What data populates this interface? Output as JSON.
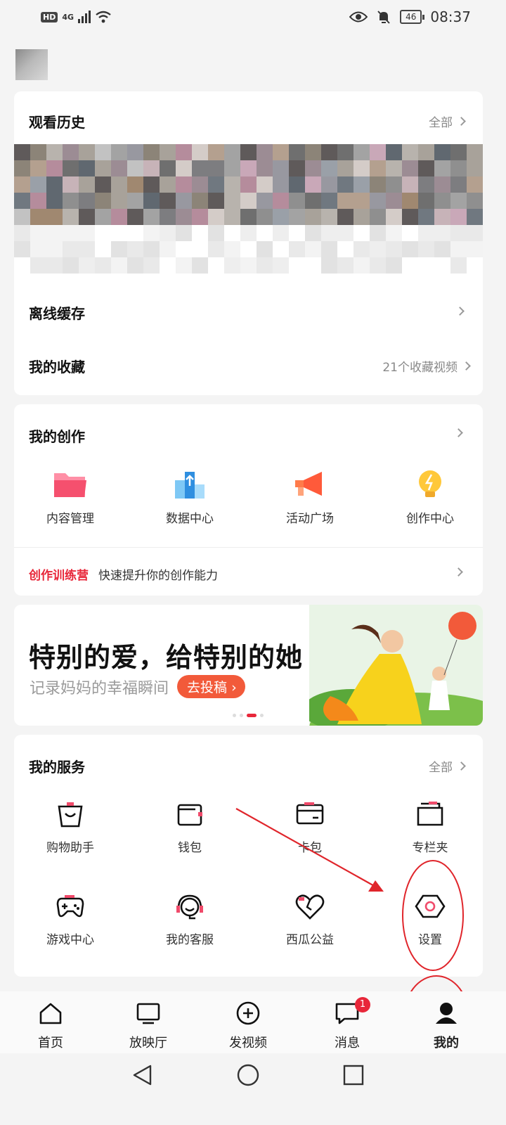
{
  "status_bar": {
    "hd": "HD",
    "network": "4G",
    "battery": "46",
    "time": "08:37"
  },
  "history": {
    "title": "观看历史",
    "all_label": "全部"
  },
  "offline": {
    "label": "离线缓存"
  },
  "favorites": {
    "label": "我的收藏",
    "count_text": "21个收藏视频"
  },
  "creation": {
    "title": "我的创作",
    "items": [
      {
        "label": "内容管理",
        "icon": "folder-icon"
      },
      {
        "label": "数据中心",
        "icon": "data-chart-icon"
      },
      {
        "label": "活动广场",
        "icon": "megaphone-icon"
      },
      {
        "label": "创作中心",
        "icon": "lightbulb-icon"
      }
    ],
    "camp_tag": "创作训练营",
    "camp_text": "快速提升你的创作能力"
  },
  "banner": {
    "title": "特别的爱，给特别的她",
    "subtitle": "记录妈妈的幸福瞬间",
    "button": "去投稿"
  },
  "services": {
    "title": "我的服务",
    "all_label": "全部",
    "items": [
      {
        "label": "购物助手",
        "icon": "shopping-bag-icon"
      },
      {
        "label": "钱包",
        "icon": "wallet-icon"
      },
      {
        "label": "卡包",
        "icon": "card-icon"
      },
      {
        "label": "专栏夹",
        "icon": "folder-outline-icon"
      },
      {
        "label": "游戏中心",
        "icon": "gamepad-icon"
      },
      {
        "label": "我的客服",
        "icon": "headset-icon"
      },
      {
        "label": "西瓜公益",
        "icon": "heart-icon"
      },
      {
        "label": "设置",
        "icon": "settings-icon"
      }
    ]
  },
  "bottom_nav": {
    "items": [
      {
        "label": "首页",
        "icon": "home-icon"
      },
      {
        "label": "放映厅",
        "icon": "tv-icon"
      },
      {
        "label": "发视频",
        "icon": "plus-circle-icon"
      },
      {
        "label": "消息",
        "icon": "message-icon",
        "badge": "1"
      },
      {
        "label": "我的",
        "icon": "profile-icon"
      }
    ]
  },
  "colors": {
    "accent": "#e8273a",
    "annotation_red": "#e0252b",
    "banner_button": "#f25a3a"
  }
}
